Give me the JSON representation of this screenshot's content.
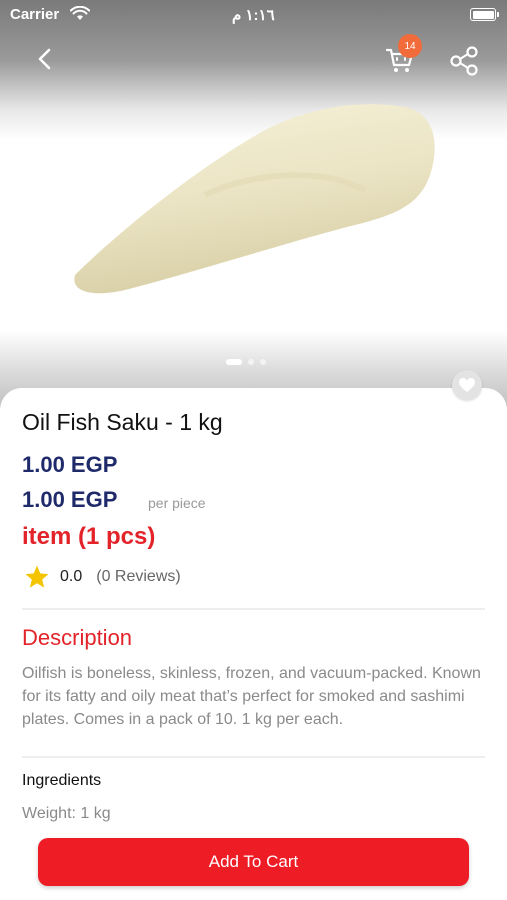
{
  "status_bar": {
    "carrier": "Carrier",
    "time": "١:١٦ م"
  },
  "header": {
    "cart_count": "14",
    "icons": [
      "back-chevron-icon",
      "cart-icon",
      "share-icon"
    ]
  },
  "gallery": {
    "slide_count": 3,
    "active_slide": 1
  },
  "product": {
    "title": "Oil Fish Saku - 1 kg",
    "price": "1.00 EGP",
    "unit_price": "1.00 EGP",
    "per_piece_label": "per piece",
    "unit_label": "item (1 pcs)",
    "rating": "0.0",
    "reviews": "(0 Reviews)"
  },
  "description": {
    "heading": "Description",
    "text": "Oilfish is boneless, skinless, frozen, and vacuum-packed. Known for its fatty and oily meat that’s perfect for smoked and sashimi plates. Comes in a pack of 10. 1 kg per each."
  },
  "ingredients": {
    "heading": "Ingredients",
    "weight": "Weight: 1 kg"
  },
  "actions": {
    "add_to_cart": "Add To Cart"
  },
  "colors": {
    "price": "#1f2a6b",
    "accent_red": "#e3232a",
    "button": "#ee1c25",
    "badge": "#f26b3a",
    "star": "#f5c400"
  }
}
